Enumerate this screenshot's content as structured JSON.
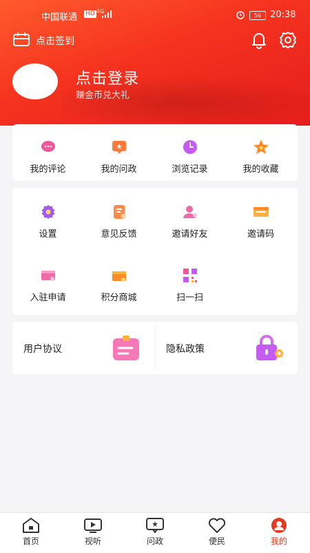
{
  "status": {
    "carrier": "中国联通",
    "net_hd": "HD",
    "net_4g": "4G",
    "battery": "56",
    "time": "20:38"
  },
  "topbar": {
    "signin_label": "点击签到"
  },
  "profile": {
    "login_title": "点击登录",
    "login_subtitle": "赚金币兑大礼"
  },
  "quick_actions": [
    {
      "label": "我的评论",
      "icon": "comment-icon",
      "color": "#f0569b"
    },
    {
      "label": "我的问政",
      "icon": "inquiry-icon",
      "color": "#ff7a3a"
    },
    {
      "label": "浏览记录",
      "icon": "clock-icon",
      "color": "#c45cf2"
    },
    {
      "label": "我的收藏",
      "icon": "star-icon",
      "color": "#ff8a26"
    }
  ],
  "tools": [
    {
      "label": "设置",
      "icon": "gear-icon"
    },
    {
      "label": "意见反馈",
      "icon": "feedback-icon"
    },
    {
      "label": "邀请好友",
      "icon": "invite-friend-icon"
    },
    {
      "label": "邀请码",
      "icon": "invite-code-icon"
    },
    {
      "label": "入驻申请",
      "icon": "application-icon"
    },
    {
      "label": "积分商城",
      "icon": "points-mall-icon"
    },
    {
      "label": "扫一扫",
      "icon": "qr-scan-icon"
    }
  ],
  "agreements": {
    "user_agreement": "用户协议",
    "privacy_policy": "隐私政策"
  },
  "tabs": [
    {
      "label": "首页",
      "icon": "home-icon"
    },
    {
      "label": "视听",
      "icon": "video-icon"
    },
    {
      "label": "问政",
      "icon": "inquiry-tab-icon"
    },
    {
      "label": "便民",
      "icon": "service-icon"
    },
    {
      "label": "我的",
      "icon": "profile-icon",
      "active": true
    }
  ],
  "colors": {
    "accent": "#e53a20",
    "header_gradient_start": "#ff5a2c",
    "header_gradient_end": "#e51d1d"
  }
}
